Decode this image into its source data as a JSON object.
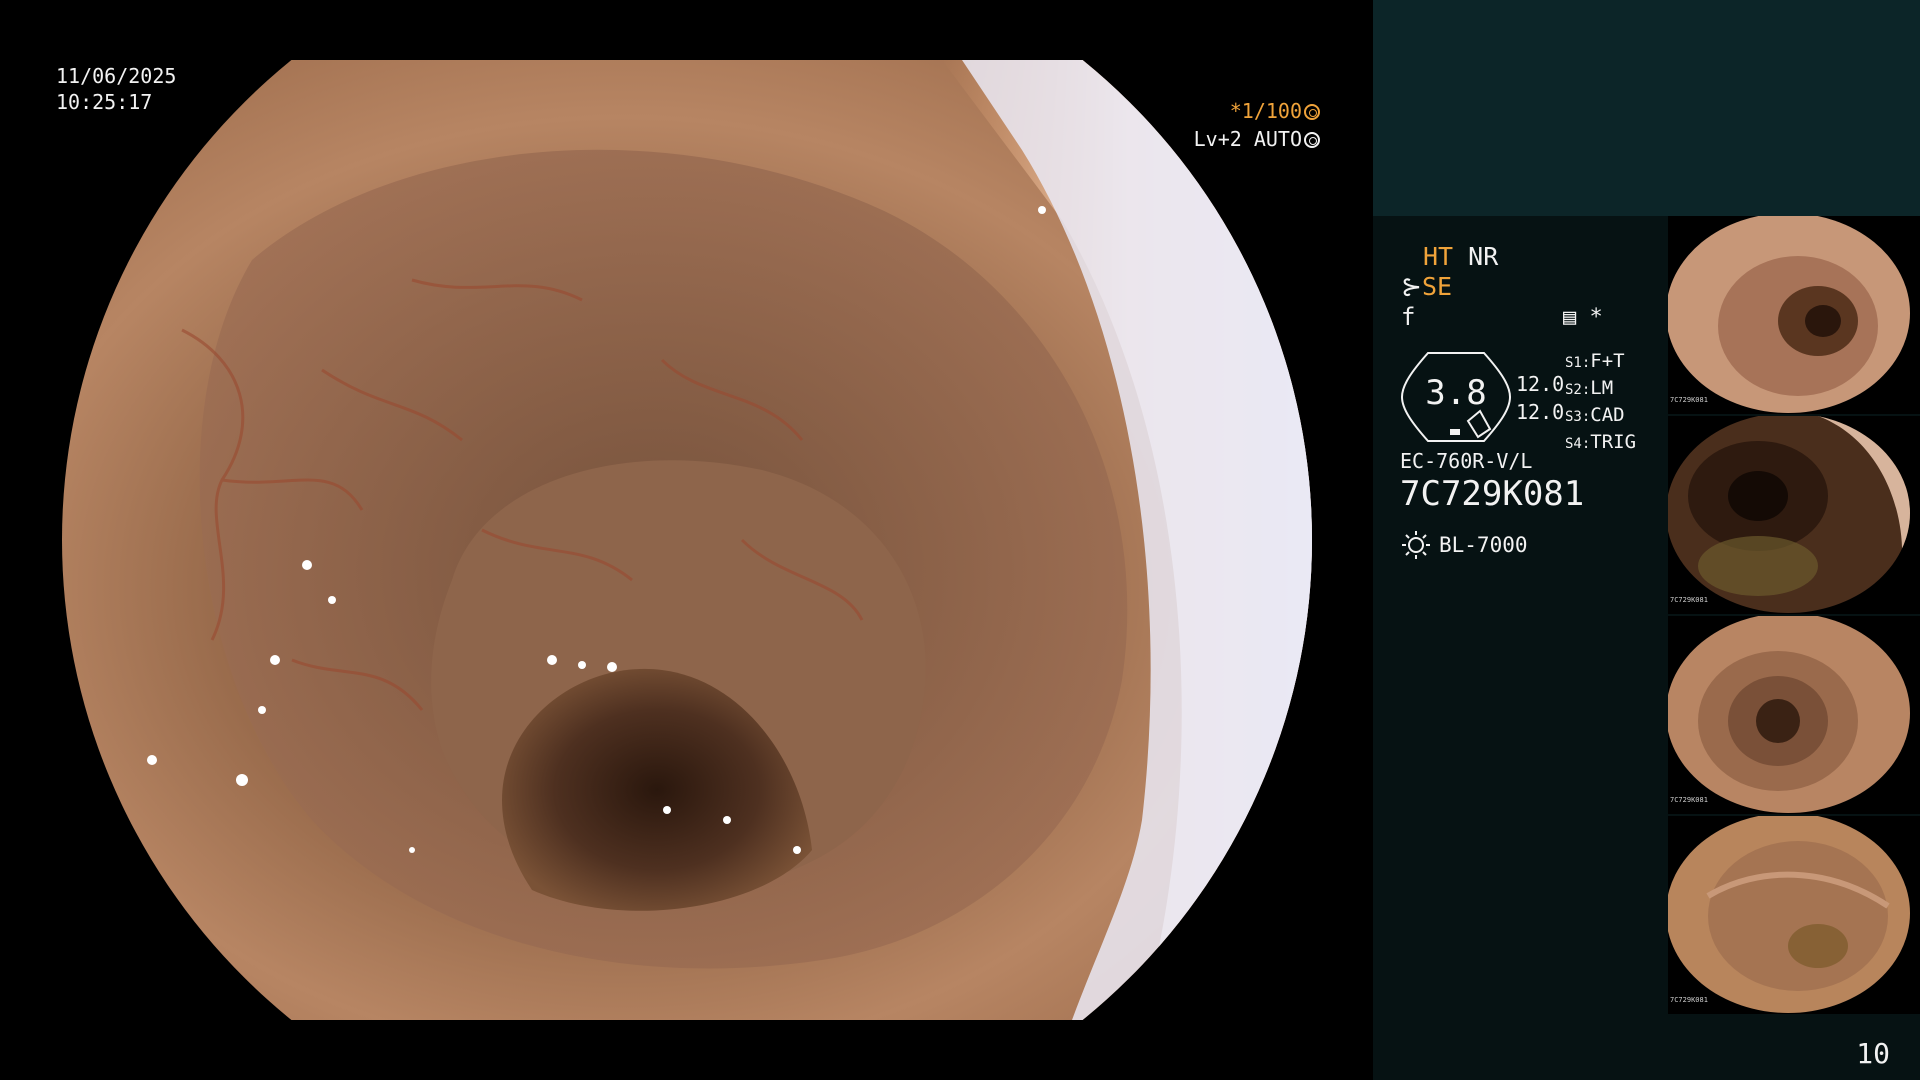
{
  "overlay": {
    "date": "11/06/2025",
    "time": "10:25:17",
    "shutter": "*1/100",
    "level": "Lv+2 AUTO"
  },
  "panel": {
    "ht": "HT",
    "nr": "NR",
    "se": "SE",
    "f_symbol": "f",
    "asterisk": "*",
    "zoom": "3.8",
    "num_top": "12.0",
    "num_bottom": "12.0",
    "modes": [
      {
        "key": "S1:",
        "value": "F+T"
      },
      {
        "key": "S2:",
        "value": "LM"
      },
      {
        "key": "S3:",
        "value": "CAD"
      },
      {
        "key": "S4:",
        "value": "TRIG"
      }
    ],
    "scope_model": "EC-760R-V/L",
    "serial": "7C729K081",
    "light_source": "BL-7000"
  },
  "thumbnails": [
    {
      "serial": "7C729K081",
      "variant": "light"
    },
    {
      "serial": "7C729K081",
      "variant": "dark"
    },
    {
      "serial": "7C729K081",
      "variant": "medium"
    },
    {
      "serial": "7C729K081",
      "variant": "medium"
    }
  ],
  "frame_count": "10",
  "colors": {
    "accent": "#f0a33a",
    "panel_bg": "#061213",
    "panel_top": "#0c2528",
    "mucosa": "#b07850"
  }
}
